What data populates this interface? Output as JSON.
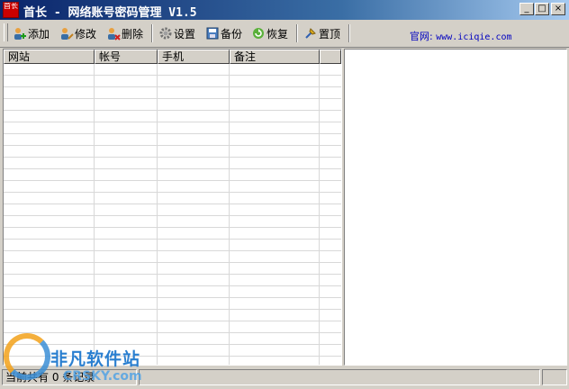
{
  "window": {
    "title": "首长 - 网络账号密码管理 V1.5",
    "icon_text": "首长",
    "buttons": {
      "minimize": "_",
      "maximize": "□",
      "close": "×"
    }
  },
  "toolbar": {
    "items": [
      {
        "label": "添加",
        "icon": "user-add-icon"
      },
      {
        "label": "修改",
        "icon": "user-edit-icon"
      },
      {
        "label": "删除",
        "icon": "user-delete-icon"
      },
      {
        "label": "设置",
        "icon": "gear-icon"
      },
      {
        "label": "备份",
        "icon": "backup-icon"
      },
      {
        "label": "恢复",
        "icon": "restore-icon"
      },
      {
        "label": "置顶",
        "icon": "pin-top-icon"
      }
    ],
    "site_label": "官网:",
    "site_url": "www.iciqie.com"
  },
  "table": {
    "columns": [
      "网站",
      "帐号",
      "手机",
      "备注",
      ""
    ],
    "rows": []
  },
  "status": {
    "text": "当前共有 0 条记录",
    "watermark_cn": "非凡软件站",
    "watermark_en": "CRSKY.com"
  },
  "colors": {
    "titlebar_start": "#0a246a",
    "titlebar_end": "#a6caf0",
    "link": "#0000c0",
    "face": "#d4d0c8"
  }
}
